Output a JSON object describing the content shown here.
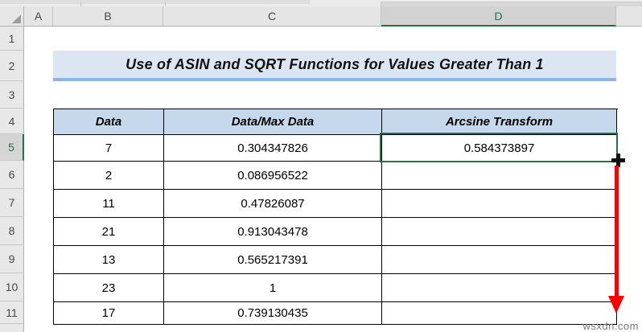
{
  "grid": {
    "column_headers": [
      "A",
      "B",
      "C",
      "D"
    ],
    "row_headers": [
      "1",
      "2",
      "3",
      "4",
      "5",
      "6",
      "7",
      "8",
      "9",
      "10",
      "11"
    ],
    "selected_column": "D",
    "selected_row": "5",
    "active_cell": "D5"
  },
  "title": "Use of ASIN and SQRT Functions for Values Greater Than 1",
  "table": {
    "headers": [
      "Data",
      "Data/Max Data",
      "Arcsine Transform"
    ],
    "rows": [
      [
        "7",
        "0.304347826",
        "0.584373897"
      ],
      [
        "2",
        "0.086956522",
        ""
      ],
      [
        "11",
        "0.47826087",
        ""
      ],
      [
        "21",
        "0.913043478",
        ""
      ],
      [
        "13",
        "0.565217391",
        ""
      ],
      [
        "23",
        "1",
        ""
      ],
      [
        "17",
        "0.739130435",
        ""
      ]
    ]
  },
  "annotations": {
    "fill_handle": "black-plus-fill-handle-cursor",
    "drag_arrow": "red-arrow-down-from-D5-to-D11"
  },
  "watermark": "wsxdn.com",
  "colors": {
    "selection_green": "#217346",
    "arrow_red": "#fe0000",
    "table_header_blue": "#c6d9ec",
    "title_banner_blue": "#dce6f2",
    "title_underline_blue": "#95b3d7",
    "header_gray": "#e5e5e5",
    "selected_header_gray": "#d2d2d2"
  }
}
